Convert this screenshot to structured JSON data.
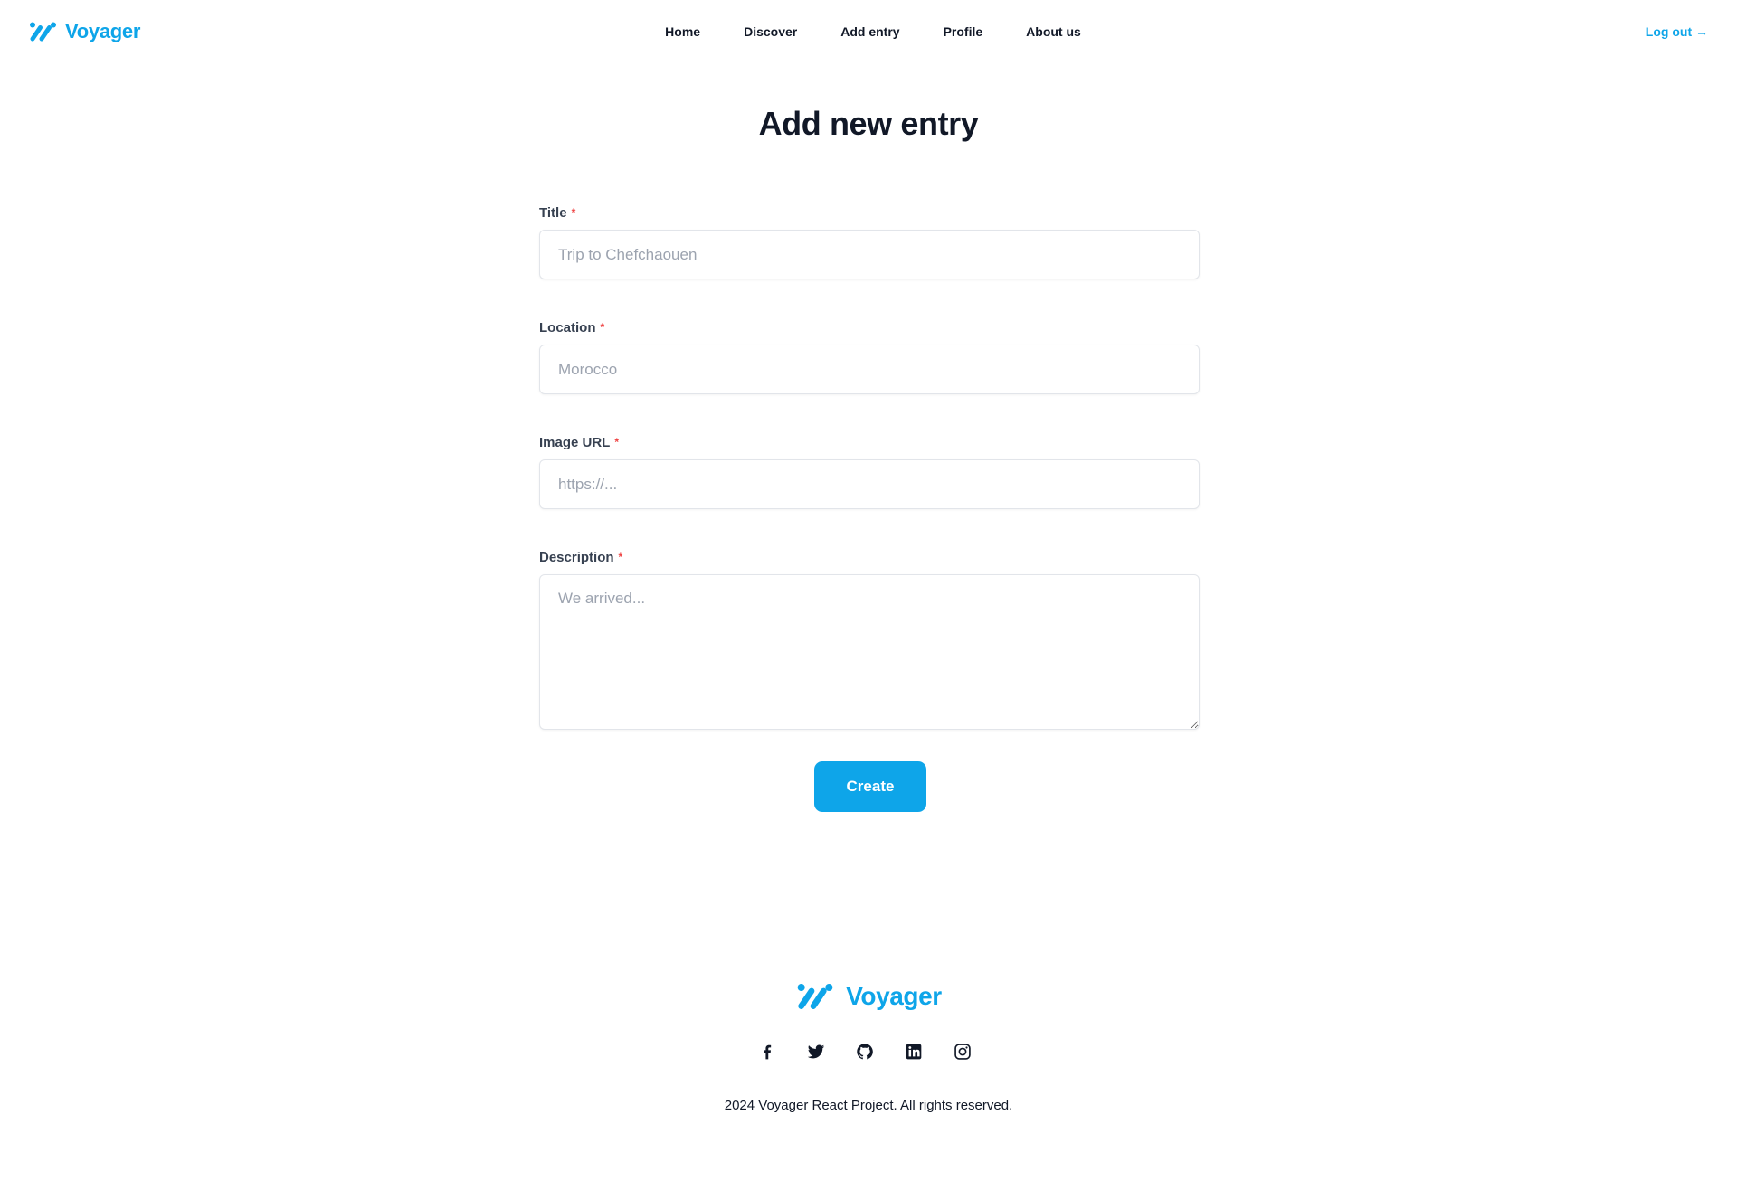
{
  "header": {
    "brand": "Voyager",
    "nav": [
      "Home",
      "Discover",
      "Add entry",
      "Profile",
      "About us"
    ],
    "logout": "Log out →"
  },
  "form": {
    "title": "Add new entry",
    "fields": [
      {
        "label": "Title",
        "required_mark": "*",
        "placeholder": "Trip to Chefchaouen"
      },
      {
        "label": "Location",
        "required_mark": "*",
        "placeholder": "Morocco"
      },
      {
        "label": "Image URL",
        "required_mark": "*",
        "placeholder": "https://..."
      },
      {
        "label": "Description",
        "required_mark": "*",
        "placeholder": "We arrived..."
      }
    ],
    "submit": "Create"
  },
  "footer": {
    "brand": "Voyager",
    "socials": [
      "facebook-icon",
      "twitter-icon",
      "github-icon",
      "linkedin-icon",
      "instagram-icon"
    ],
    "copyright": "2024 Voyager React Project. All rights reserved."
  },
  "colors": {
    "accent": "#0ea5e9",
    "required": "#ef4444",
    "text": "#111827"
  }
}
